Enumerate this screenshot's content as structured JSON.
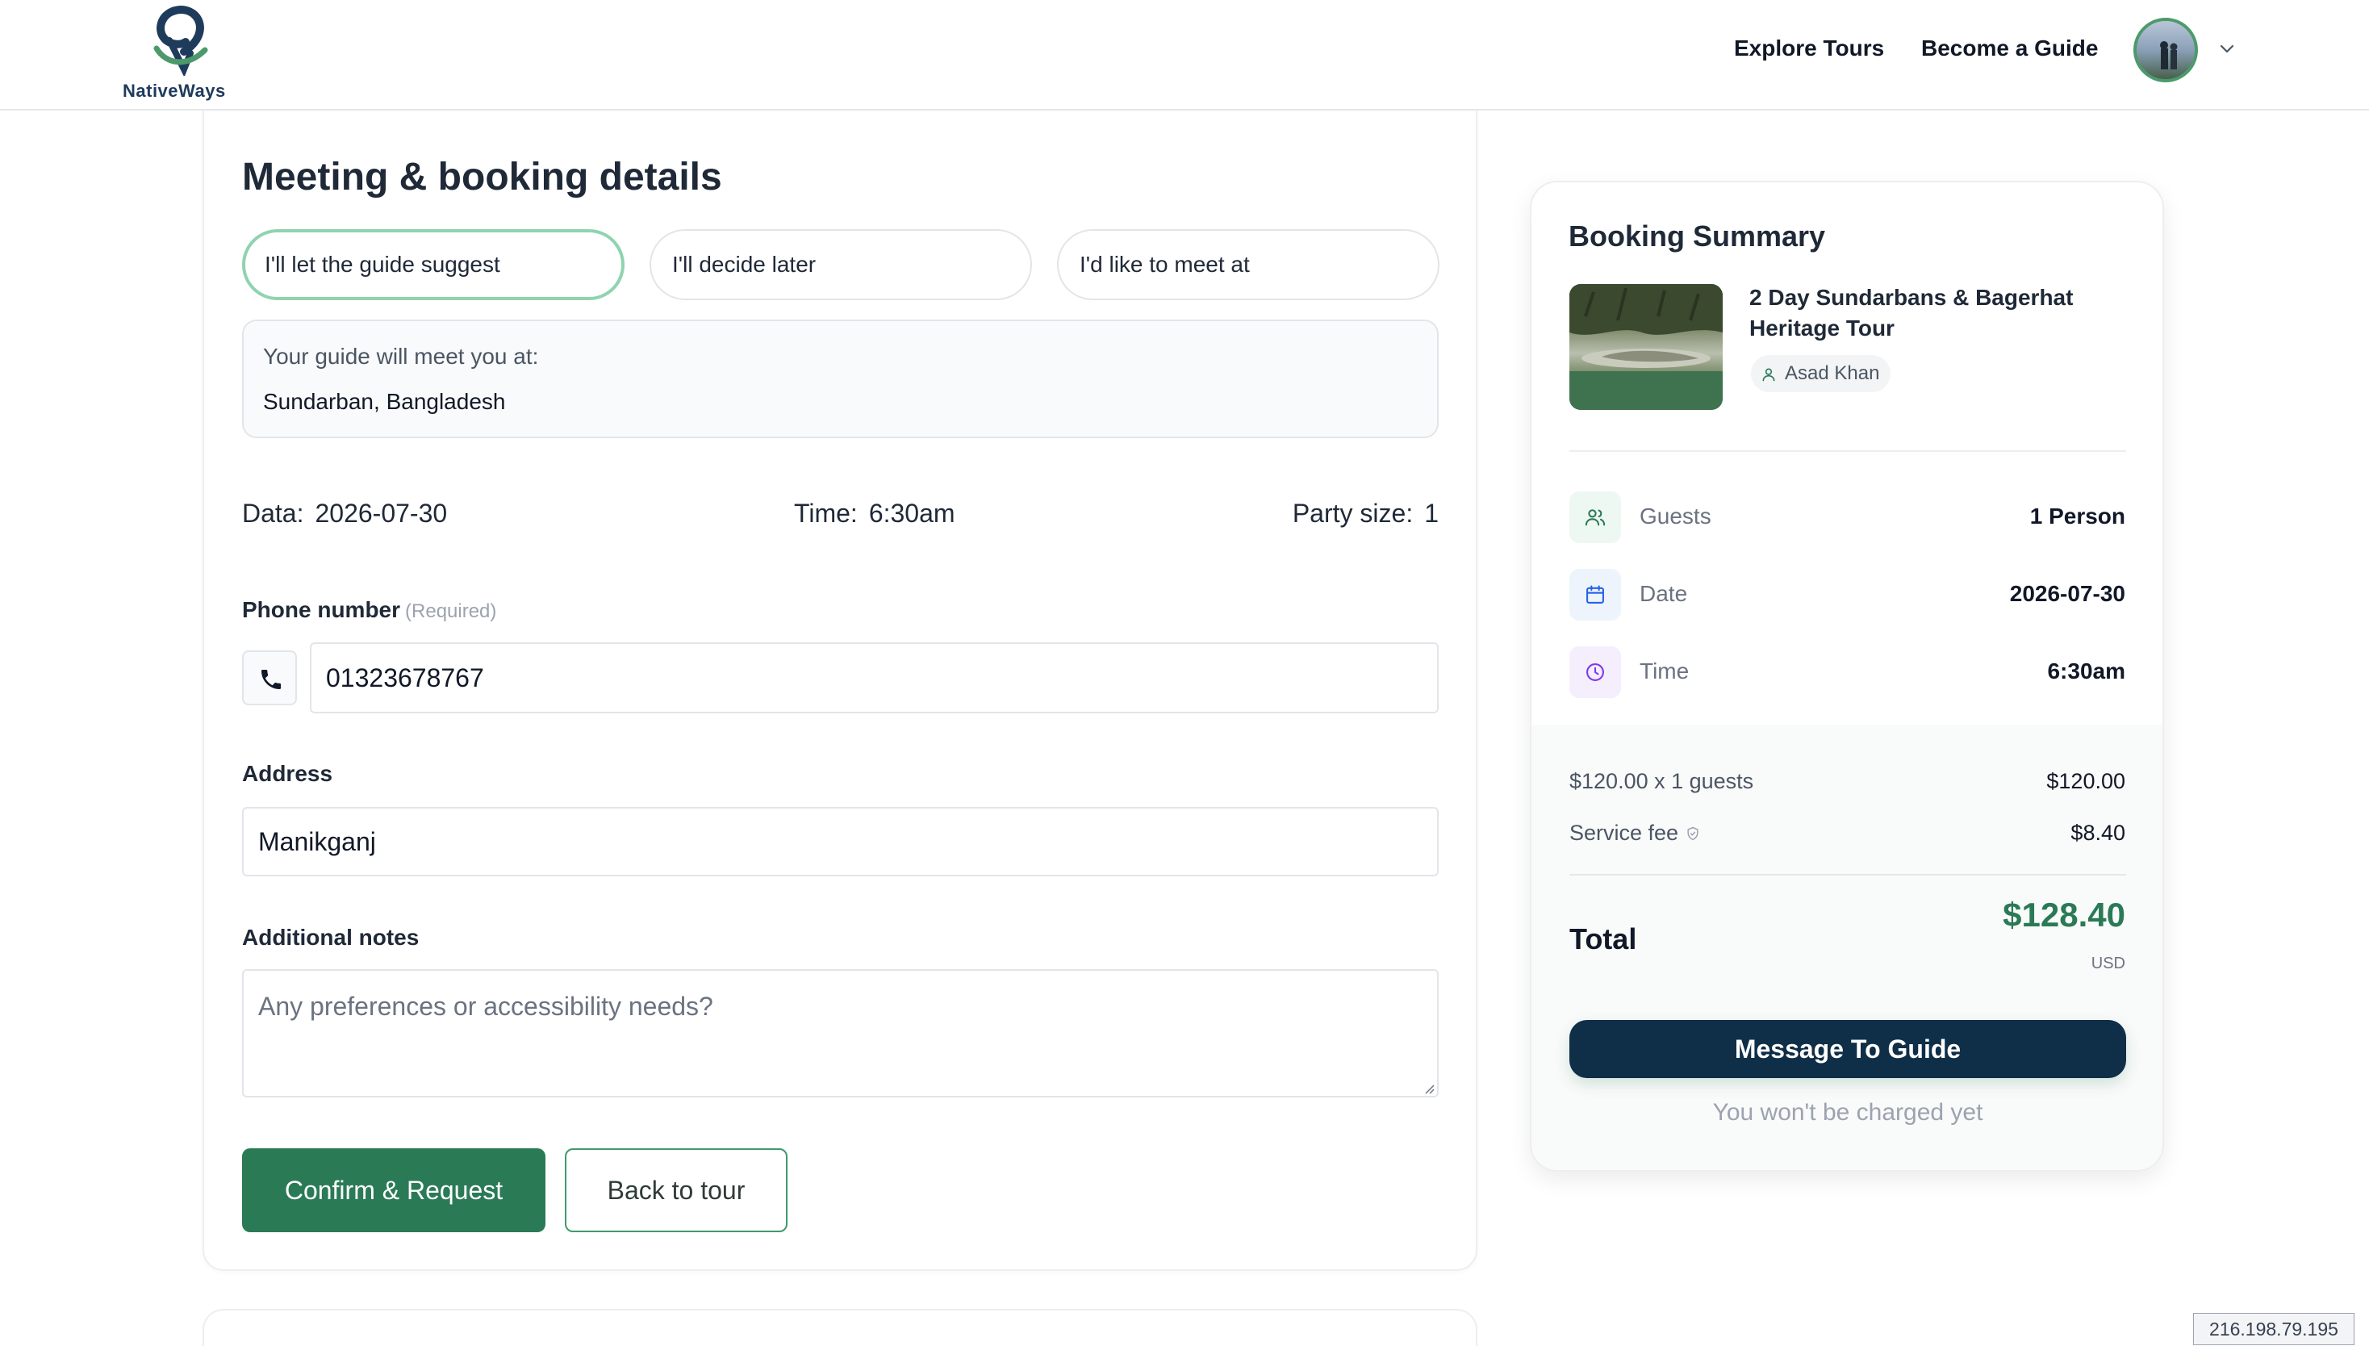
{
  "header": {
    "brand": "NativeWays",
    "nav": [
      {
        "label": "Explore Tours"
      },
      {
        "label": "Become a Guide"
      }
    ],
    "icons": {
      "avatar": "user-avatar",
      "chevron": "chevron-down-icon"
    }
  },
  "booking": {
    "title": "Meeting & booking details",
    "meeting_options": [
      {
        "label": "I'll let the guide suggest",
        "selected": true
      },
      {
        "label": "I'll decide later",
        "selected": false
      },
      {
        "label": "I'd like to meet at",
        "selected": false
      }
    ],
    "meet_box": {
      "label": "Your guide will meet you at:",
      "value": "Sundarban, Bangladesh"
    },
    "info": {
      "date_label": "Data:",
      "date_value": "2026-07-30",
      "time_label": "Time:",
      "time_value": "6:30am",
      "party_label": "Party size:",
      "party_value": "1"
    },
    "phone": {
      "label": "Phone number",
      "required_note": "(Required)",
      "value": "01323678767",
      "icon": "phone-icon"
    },
    "address": {
      "label": "Address",
      "value": "Manikganj"
    },
    "notes": {
      "label": "Additional notes",
      "placeholder": "Any preferences or accessibility needs?",
      "value": ""
    },
    "buttons": {
      "confirm": "Confirm & Request",
      "back": "Back to tour"
    }
  },
  "summary": {
    "title": "Booking Summary",
    "tour_title": "2 Day Sundarbans & Bagerhat Heritage Tour",
    "guide_name": "Asad Khan",
    "rows": [
      {
        "label": "Guests",
        "value": "1 Person",
        "icon": "users-icon"
      },
      {
        "label": "Date",
        "value": "2026-07-30",
        "icon": "calendar-icon"
      },
      {
        "label": "Time",
        "value": "6:30am",
        "icon": "clock-icon"
      }
    ],
    "pricing": {
      "base_label": "$120.00 x 1 guests",
      "base_value": "$120.00",
      "fee_label": "Service fee",
      "fee_value": "$8.40",
      "total_label": "Total",
      "total_value": "$128.40",
      "currency": "USD"
    },
    "message_button": "Message To Guide",
    "charge_note": "You won't be charged yet"
  },
  "status": {
    "ip": "216.198.79.195"
  },
  "colors": {
    "accent": "#2a7a56",
    "navy": "#0f2e47",
    "selected_border": "#8fd3b0"
  }
}
